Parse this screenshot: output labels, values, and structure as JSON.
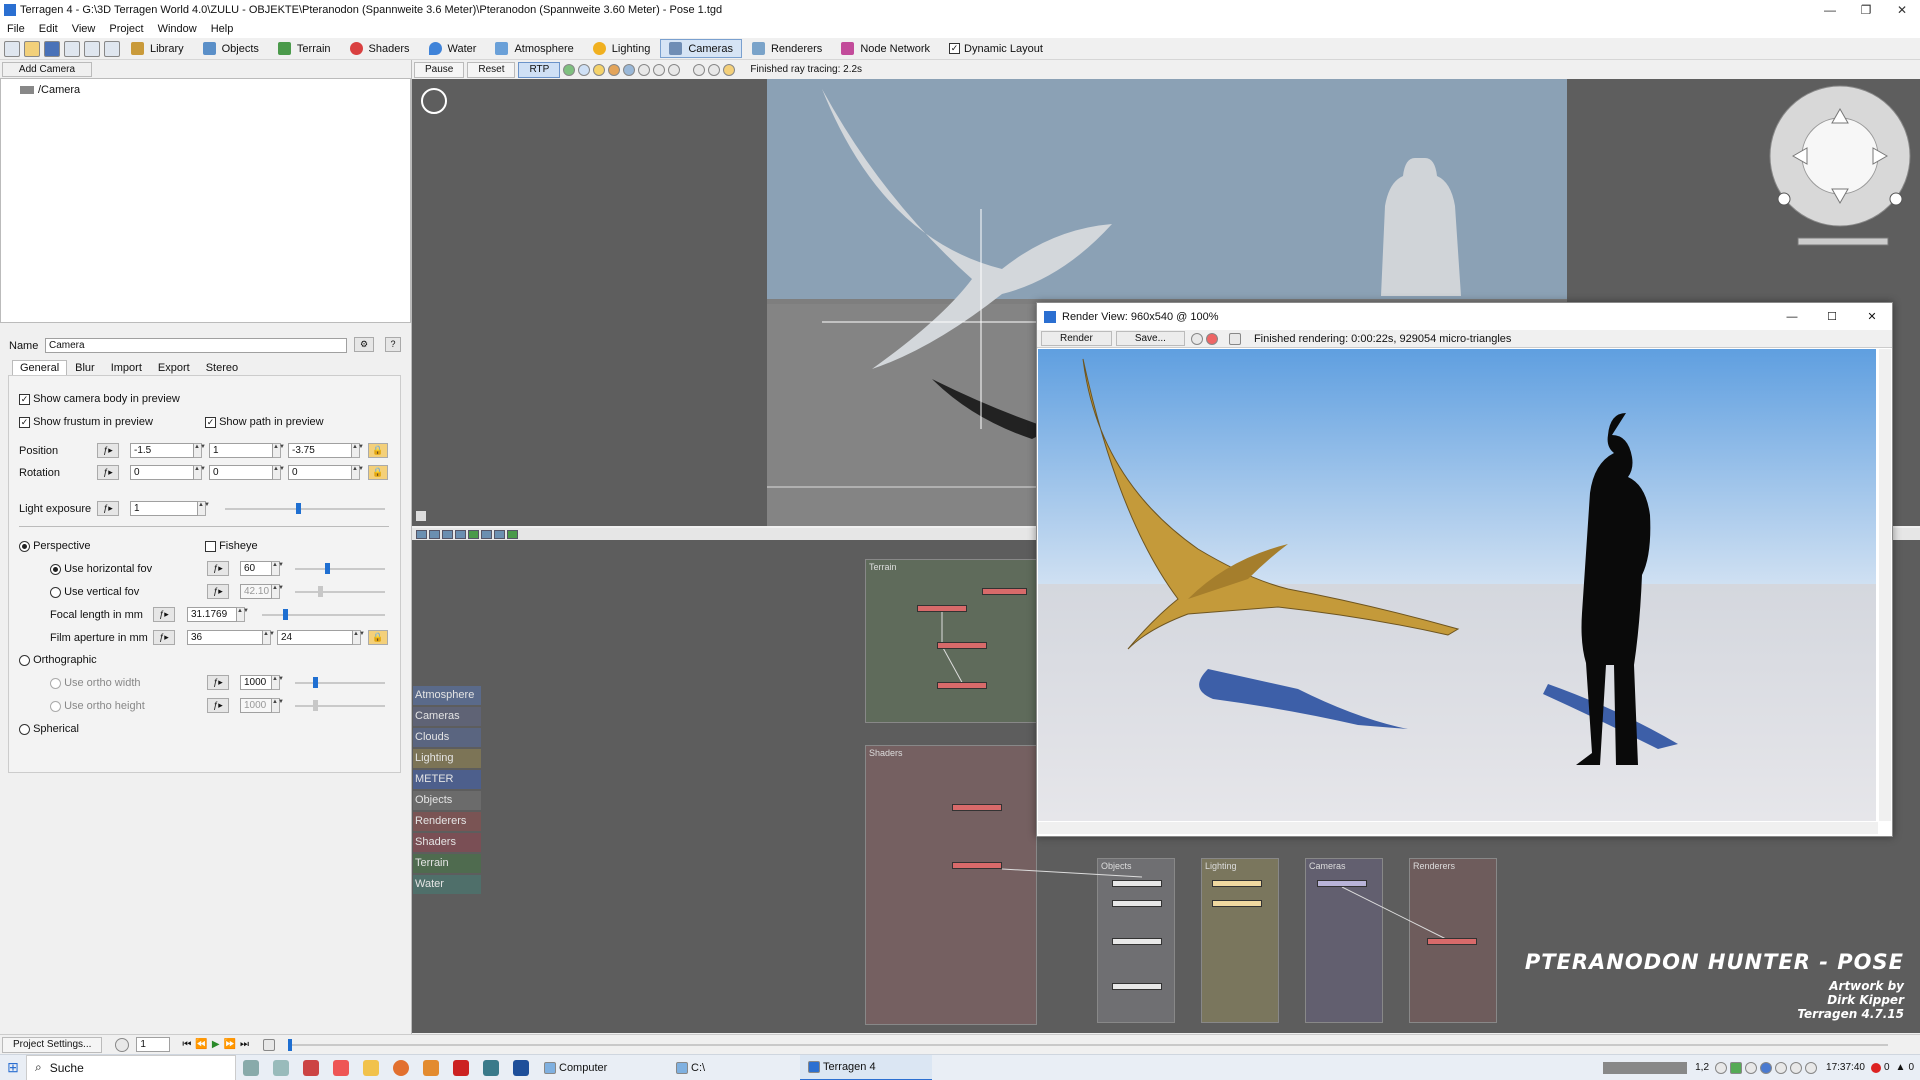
{
  "window": {
    "title": "Terragen 4 - G:\\3D Terragen World 4.0\\ZULU - OBJEKTE\\Pteranodon (Spannweite 3.6 Meter)\\Pteranodon (Spannweite 3.60 Meter) - Pose 1.tgd",
    "min": "—",
    "max": "❐",
    "close": "✕"
  },
  "menu": [
    "File",
    "Edit",
    "View",
    "Project",
    "Window",
    "Help"
  ],
  "toolbar_tabs": [
    {
      "label": "Library",
      "icon": "library-icon",
      "color": "#c99a3a"
    },
    {
      "label": "Objects",
      "icon": "cube-icon",
      "color": "#5a8fc8"
    },
    {
      "label": "Terrain",
      "icon": "mountain-icon",
      "color": "#4b9a4b"
    },
    {
      "label": "Shaders",
      "icon": "sphere-icon",
      "color": "#d94040"
    },
    {
      "label": "Water",
      "icon": "drop-icon",
      "color": "#3f83d9"
    },
    {
      "label": "Atmosphere",
      "icon": "cloud-icon",
      "color": "#6aa0d8"
    },
    {
      "label": "Lighting",
      "icon": "sun-icon",
      "color": "#f0b020"
    },
    {
      "label": "Cameras",
      "icon": "camera-icon",
      "color": "#6f8db5",
      "active": true
    },
    {
      "label": "Renderers",
      "icon": "landscape-icon",
      "color": "#7aa3c9"
    },
    {
      "label": "Node Network",
      "icon": "node-network-icon",
      "color": "#c24b9a"
    }
  ],
  "dynamic_layout": {
    "label": "Dynamic Layout",
    "checked": true
  },
  "rtp_bar": {
    "pause": "Pause",
    "reset": "Reset",
    "rtp": "RTP",
    "status": "Finished ray tracing: 2.2s"
  },
  "left": {
    "add_camera": "Add Camera",
    "tree_item": "/Camera",
    "name_label": "Name",
    "name_value": "Camera",
    "help": "?",
    "tabs": [
      "General",
      "Blur",
      "Import",
      "Export",
      "Stereo"
    ],
    "show_body": "Show camera body in preview",
    "show_frustum": "Show frustum in preview",
    "show_path": "Show path in preview",
    "position_label": "Position",
    "position": [
      "-1.5",
      "1",
      "-3.75"
    ],
    "rotation_label": "Rotation",
    "rotation": [
      "0",
      "0",
      "0"
    ],
    "light_exposure_label": "Light exposure",
    "light_exposure": "1",
    "perspective": "Perspective",
    "fisheye": "Fisheye",
    "use_hfov": "Use horizontal fov",
    "hfov": "60",
    "use_vfov": "Use vertical fov",
    "vfov": "42.10",
    "focal_label": "Focal length in mm",
    "focal": "31.1769",
    "aperture_label": "Film aperture in mm",
    "aperture": [
      "36",
      "24"
    ],
    "orthographic": "Orthographic",
    "ortho_width_label": "Use ortho width",
    "ortho_width": "1000",
    "ortho_height_label": "Use ortho height",
    "ortho_height": "1000",
    "spherical": "Spherical"
  },
  "node_tags": [
    {
      "label": "Atmosphere",
      "color": "#5a6a8a"
    },
    {
      "label": "Cameras",
      "color": "#5f6375"
    },
    {
      "label": "Clouds",
      "color": "#5a6580"
    },
    {
      "label": "Lighting",
      "color": "#7c7456"
    },
    {
      "label": "METER",
      "color": "#4d5f8c"
    },
    {
      "label": "Objects",
      "color": "#6b6b6b"
    },
    {
      "label": "Renderers",
      "color": "#7a5454"
    },
    {
      "label": "Shaders",
      "color": "#7a4f55"
    },
    {
      "label": "Terrain",
      "color": "#4f6b4f"
    },
    {
      "label": "Water",
      "color": "#4f6f6a"
    }
  ],
  "node_groups": {
    "terrain": "Terrain",
    "shaders": "Shaders",
    "objects": "Objects",
    "lighting": "Lighting",
    "cameras": "Cameras",
    "renderers": "Renderers"
  },
  "render_view": {
    "title": "Render View: 960x540 @ 100%",
    "render": "Render",
    "save": "Save...",
    "status": "Finished rendering:  0:00:22s, 929054 micro-triangles"
  },
  "watermark": {
    "title": "PTERANODON HUNTER - POSE",
    "line1": "Artwork by",
    "line2": "Dirk Kipper",
    "line3": "Terragen 4.7.15"
  },
  "bottom": {
    "project_settings": "Project Settings...",
    "frame": "1"
  },
  "taskbar": {
    "search": "Suche",
    "apps": [
      {
        "label": "Computer",
        "active": false
      },
      {
        "label": "C:\\",
        "active": false
      },
      {
        "label": "Terragen 4",
        "active": true
      }
    ],
    "tray_num": "1,2",
    "time": "17:37:40",
    "badge1": "0",
    "badge2": "0"
  }
}
